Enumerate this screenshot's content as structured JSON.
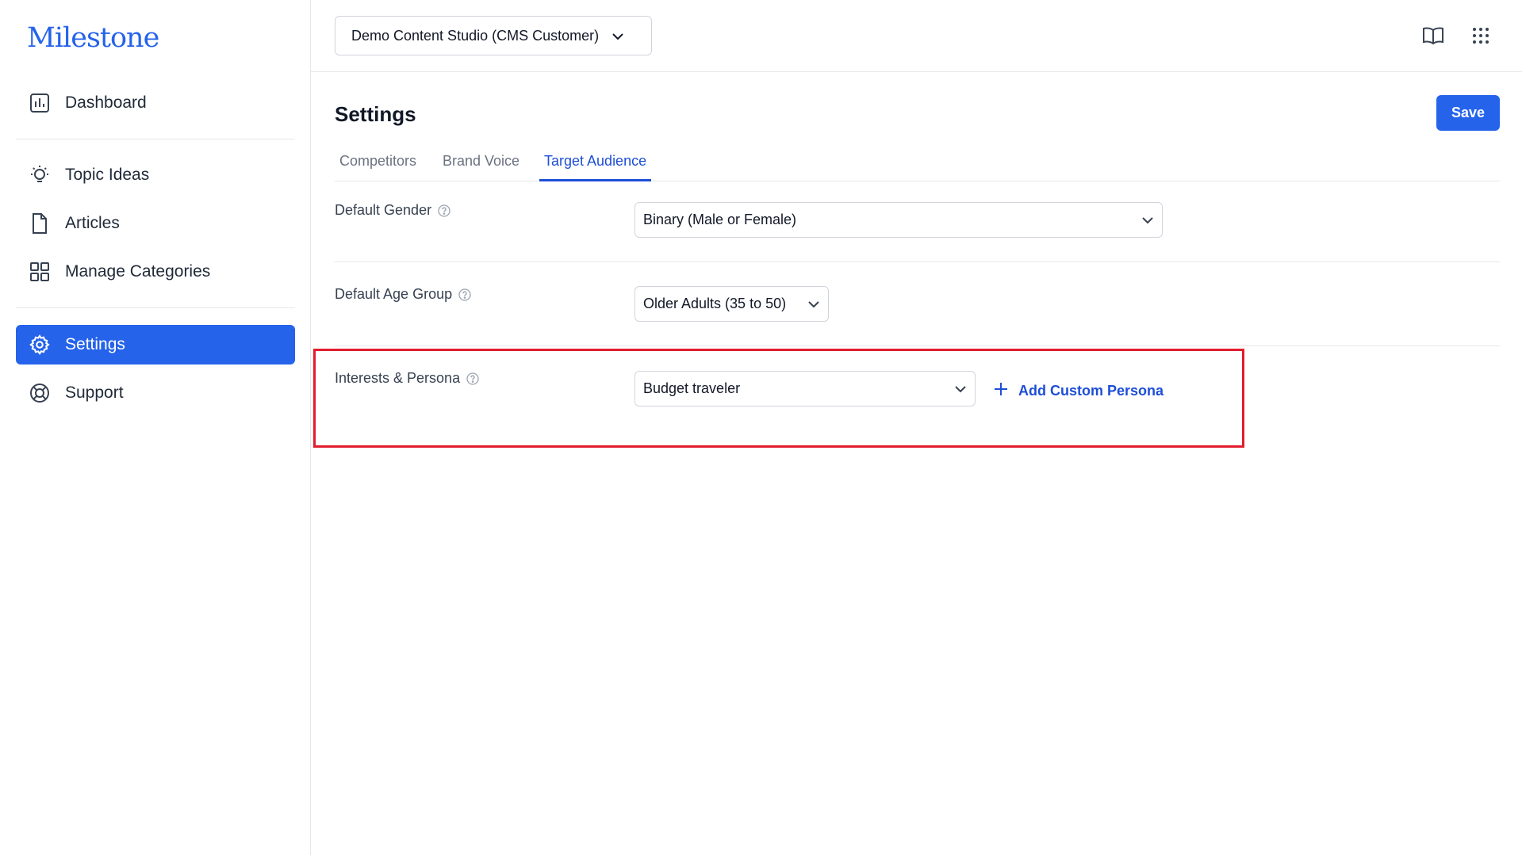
{
  "brand": {
    "logo": "Milestone",
    "accent": "#2563eb",
    "highlight_color": "#e11d2e"
  },
  "sidebar": {
    "items": [
      {
        "label": "Dashboard",
        "icon": "bar-chart-icon"
      },
      {
        "label": "Topic Ideas",
        "icon": "lightbulb-icon"
      },
      {
        "label": "Articles",
        "icon": "document-icon"
      },
      {
        "label": "Manage Categories",
        "icon": "grid-icon"
      },
      {
        "label": "Settings",
        "icon": "gear-icon",
        "active": true
      },
      {
        "label": "Support",
        "icon": "lifebuoy-icon"
      }
    ]
  },
  "header": {
    "workspace": "Demo Content Studio (CMS Customer)",
    "icons": [
      "book-icon",
      "apps-grid-icon"
    ]
  },
  "page": {
    "title": "Settings",
    "save_label": "Save",
    "tabs": [
      {
        "label": "Competitors"
      },
      {
        "label": "Brand Voice"
      },
      {
        "label": "Target Audience",
        "active": true
      }
    ]
  },
  "fields": {
    "gender": {
      "label": "Default Gender",
      "value": "Binary (Male or Female)"
    },
    "age": {
      "label": "Default Age Group",
      "value": "Older Adults (35 to 50)"
    },
    "persona": {
      "label": "Interests & Persona",
      "value": "Budget traveler",
      "add_label": "Add Custom Persona"
    }
  }
}
